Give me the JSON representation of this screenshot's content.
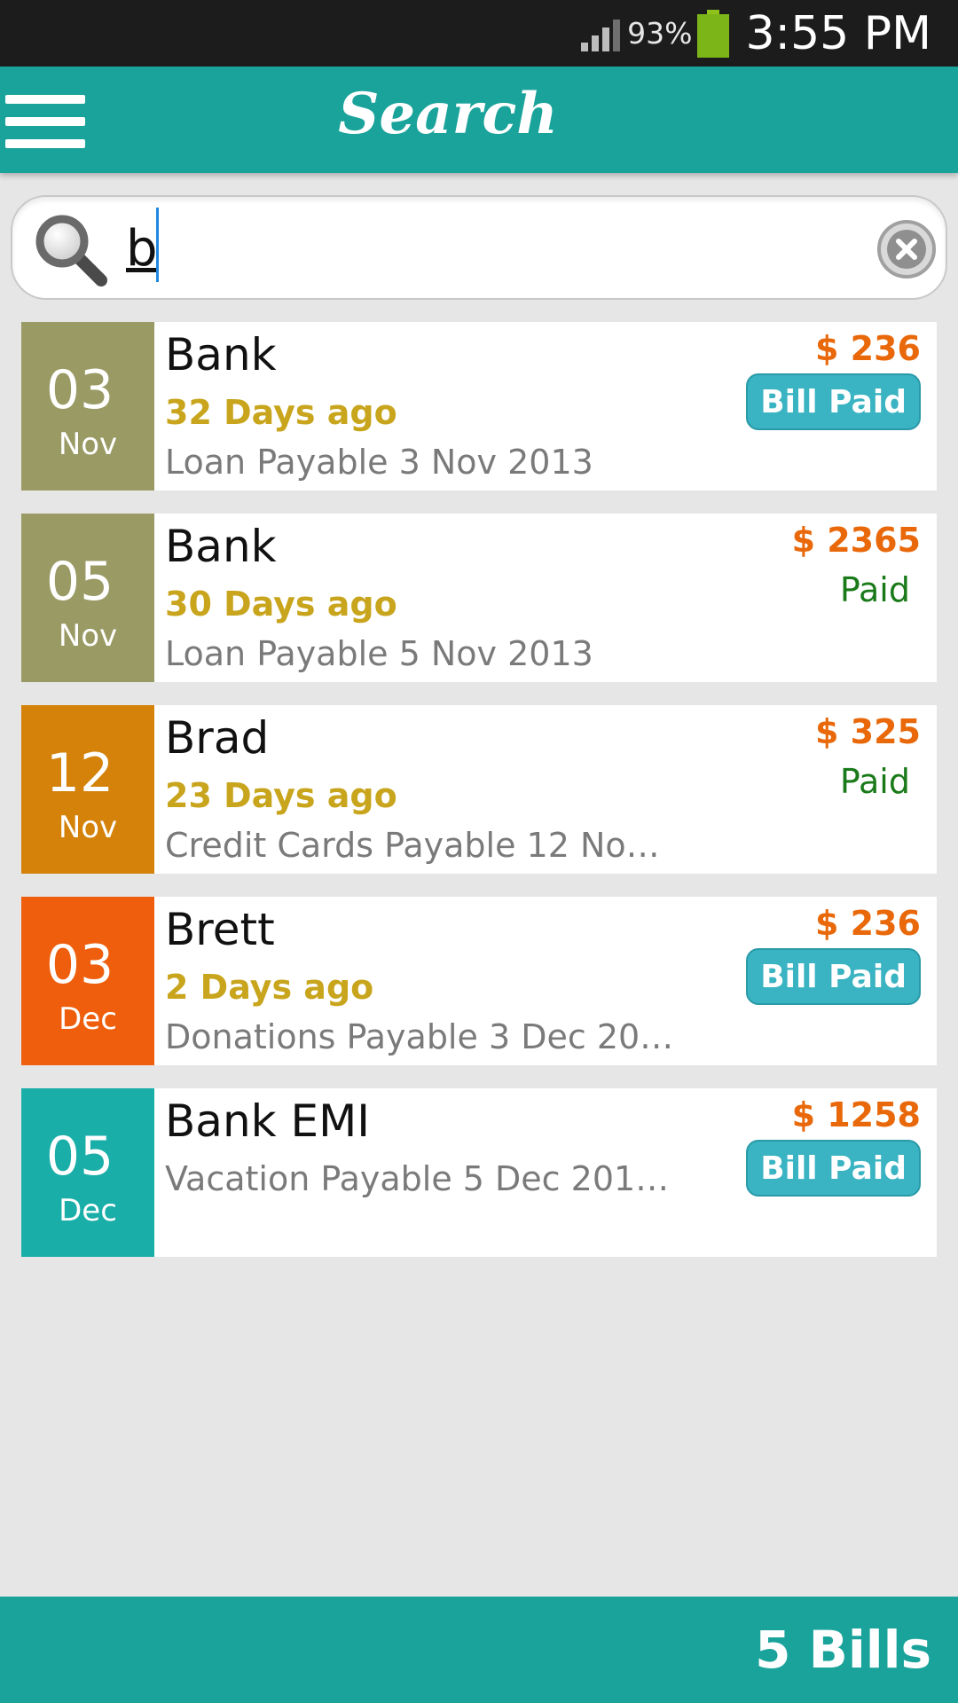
{
  "status_bar": {
    "battery_percent": "93%",
    "time": "3:55 PM"
  },
  "app_bar": {
    "title": "Search"
  },
  "search": {
    "value": "b"
  },
  "bills": [
    {
      "day": "03",
      "month": "Nov",
      "date_color": "#9a9a65",
      "payee": "Bank",
      "due_text": "32 Days ago",
      "category": "Loan",
      "payable": "Payable 3 Nov 2013",
      "detail": "Loan  Payable 3 Nov 2013",
      "amount": "$ 236",
      "status": "Bill Paid",
      "status_style": "badge"
    },
    {
      "day": "05",
      "month": "Nov",
      "date_color": "#9a9a65",
      "payee": "Bank",
      "due_text": "30 Days ago",
      "detail": "Loan  Payable 5 Nov 2013",
      "amount": "$ 2365",
      "status": "Paid",
      "status_style": "text"
    },
    {
      "day": "12",
      "month": "Nov",
      "date_color": "#d4820a",
      "payee": "Brad",
      "due_text": "23 Days ago",
      "detail": "Credit Cards  Payable 12 No…",
      "amount": "$ 325",
      "status": "Paid",
      "status_style": "text"
    },
    {
      "day": "03",
      "month": "Dec",
      "date_color": "#ee5e0c",
      "payee": "Brett",
      "due_text": "2 Days ago",
      "detail": "Donations  Payable 3 Dec 20…",
      "amount": "$ 236",
      "status": "Bill Paid",
      "status_style": "badge"
    },
    {
      "day": "05",
      "month": "Dec",
      "date_color": "#1aaea8",
      "payee": "Bank EMI",
      "due_text": "",
      "detail": "Vacation  Payable 5 Dec 201…",
      "amount": "$ 1258",
      "status": "Bill Paid",
      "status_style": "badge"
    }
  ],
  "footer": {
    "count_label": "5 Bills"
  },
  "colors": {
    "primary": "#1aa39b",
    "amount": "#e8680a",
    "due": "#c8a51c",
    "paid": "#1a7a1a",
    "badge": "#3ab3c2"
  }
}
